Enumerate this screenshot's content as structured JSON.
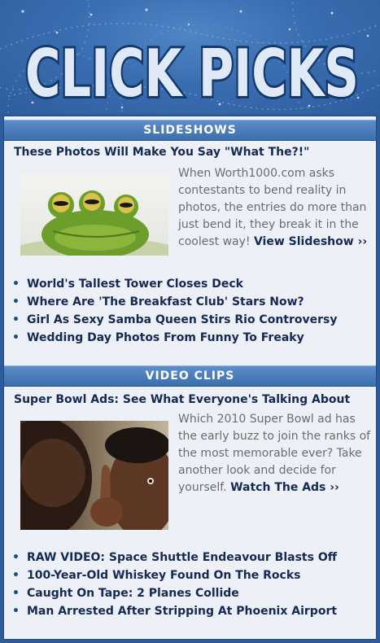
{
  "header": {
    "logo_text": "CLICK PICKS"
  },
  "slideshows": {
    "section_title": "SLIDESHOWS",
    "feature_title": "These Photos Will Make You Say \"What The?!\"",
    "thumbnail": "frog-photo",
    "blurb": "When Worth1000.com asks contestants to bend reality in photos, the entries do more than just bend it, they break it in the coolest way!",
    "cta": "View Slideshow ››",
    "links": [
      "World's Tallest Tower Closes Deck",
      "Where Are 'The Breakfast Club' Stars Now?",
      "Girl As Sexy Samba Queen Stirs Rio Controversy",
      "Wedding Day Photos From Funny To Freaky"
    ]
  },
  "video_clips": {
    "section_title": "VIDEO CLIPS",
    "feature_title": "Super Bowl Ads: See What Everyone's Talking About",
    "thumbnail": "father-son-photo",
    "blurb": "Which 2010 Super Bowl ad has the early buzz to join the ranks of the most memorable ever? Take another look and decide for yourself.",
    "cta": "Watch The Ads ››",
    "links": [
      "RAW VIDEO: Space Shuttle Endeavour Blasts Off",
      "100-Year-Old Whiskey Found On The Rocks",
      "Caught On Tape: 2 Planes Collide",
      "Man Arrested After Stripping At Phoenix Airport"
    ]
  },
  "colors": {
    "header_bg": "#3a6db0",
    "panel_bg": "#eef0f8",
    "link": "#142a52",
    "blurb_text": "#6c6c6c",
    "section_bar": "#4a7cbc"
  }
}
